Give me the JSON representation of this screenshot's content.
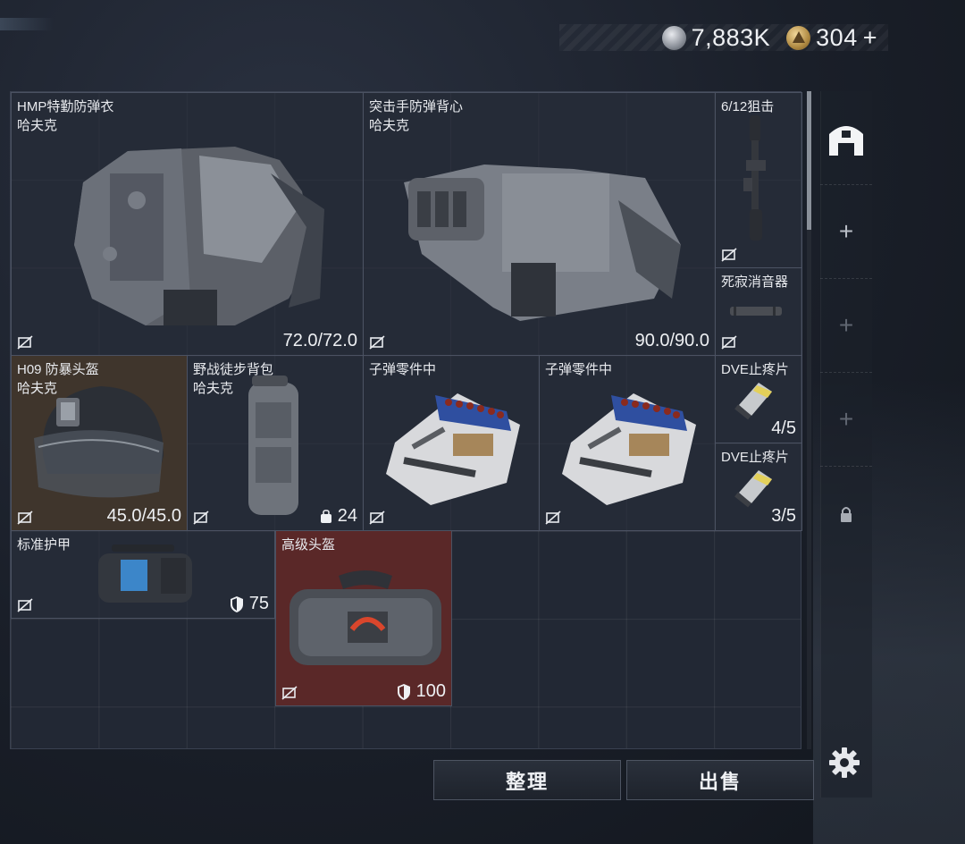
{
  "currency": {
    "silver_amount": "7,883K",
    "gold_amount": "304",
    "gold_add_symbol": "+",
    "silver_icon": "silver-coin-icon",
    "gold_icon": "gold-coin-icon"
  },
  "items": [
    {
      "name": "HMP特勤防弹衣",
      "sub": "哈夫克",
      "value": "72.0/72.0"
    },
    {
      "name": "突击手防弹背心",
      "sub": "哈夫克",
      "value": "90.0/90.0"
    },
    {
      "name": "6/12狙击",
      "sub": "",
      "value": ""
    },
    {
      "name": "死寂消音器",
      "sub": "",
      "value": ""
    },
    {
      "name": "H09 防暴头盔",
      "sub": "哈夫克",
      "value": "45.0/45.0"
    },
    {
      "name": "野战徒步背包",
      "sub": "哈夫克",
      "value": "24"
    },
    {
      "name": "子弹零件中",
      "sub": "",
      "value": ""
    },
    {
      "name": "子弹零件中",
      "sub": "",
      "value": ""
    },
    {
      "name": "DVE止疼片",
      "sub": "",
      "value": "4/5"
    },
    {
      "name": "DVE止疼片",
      "sub": "",
      "value": "3/5"
    },
    {
      "name": "标准护甲",
      "sub": "",
      "value": "75"
    },
    {
      "name": "高级头盔",
      "sub": "",
      "value": "100"
    }
  ],
  "side_slots": {
    "home_icon": "safehouse-icon",
    "add_symbol": "+",
    "lock_icon": "lock-icon",
    "settings_icon": "gear-icon"
  },
  "buttons": {
    "organize": "整理",
    "sell": "出售"
  },
  "colors": {
    "rare_item_bg": "#3f352c",
    "epic_item_bg": "#5a2828"
  }
}
